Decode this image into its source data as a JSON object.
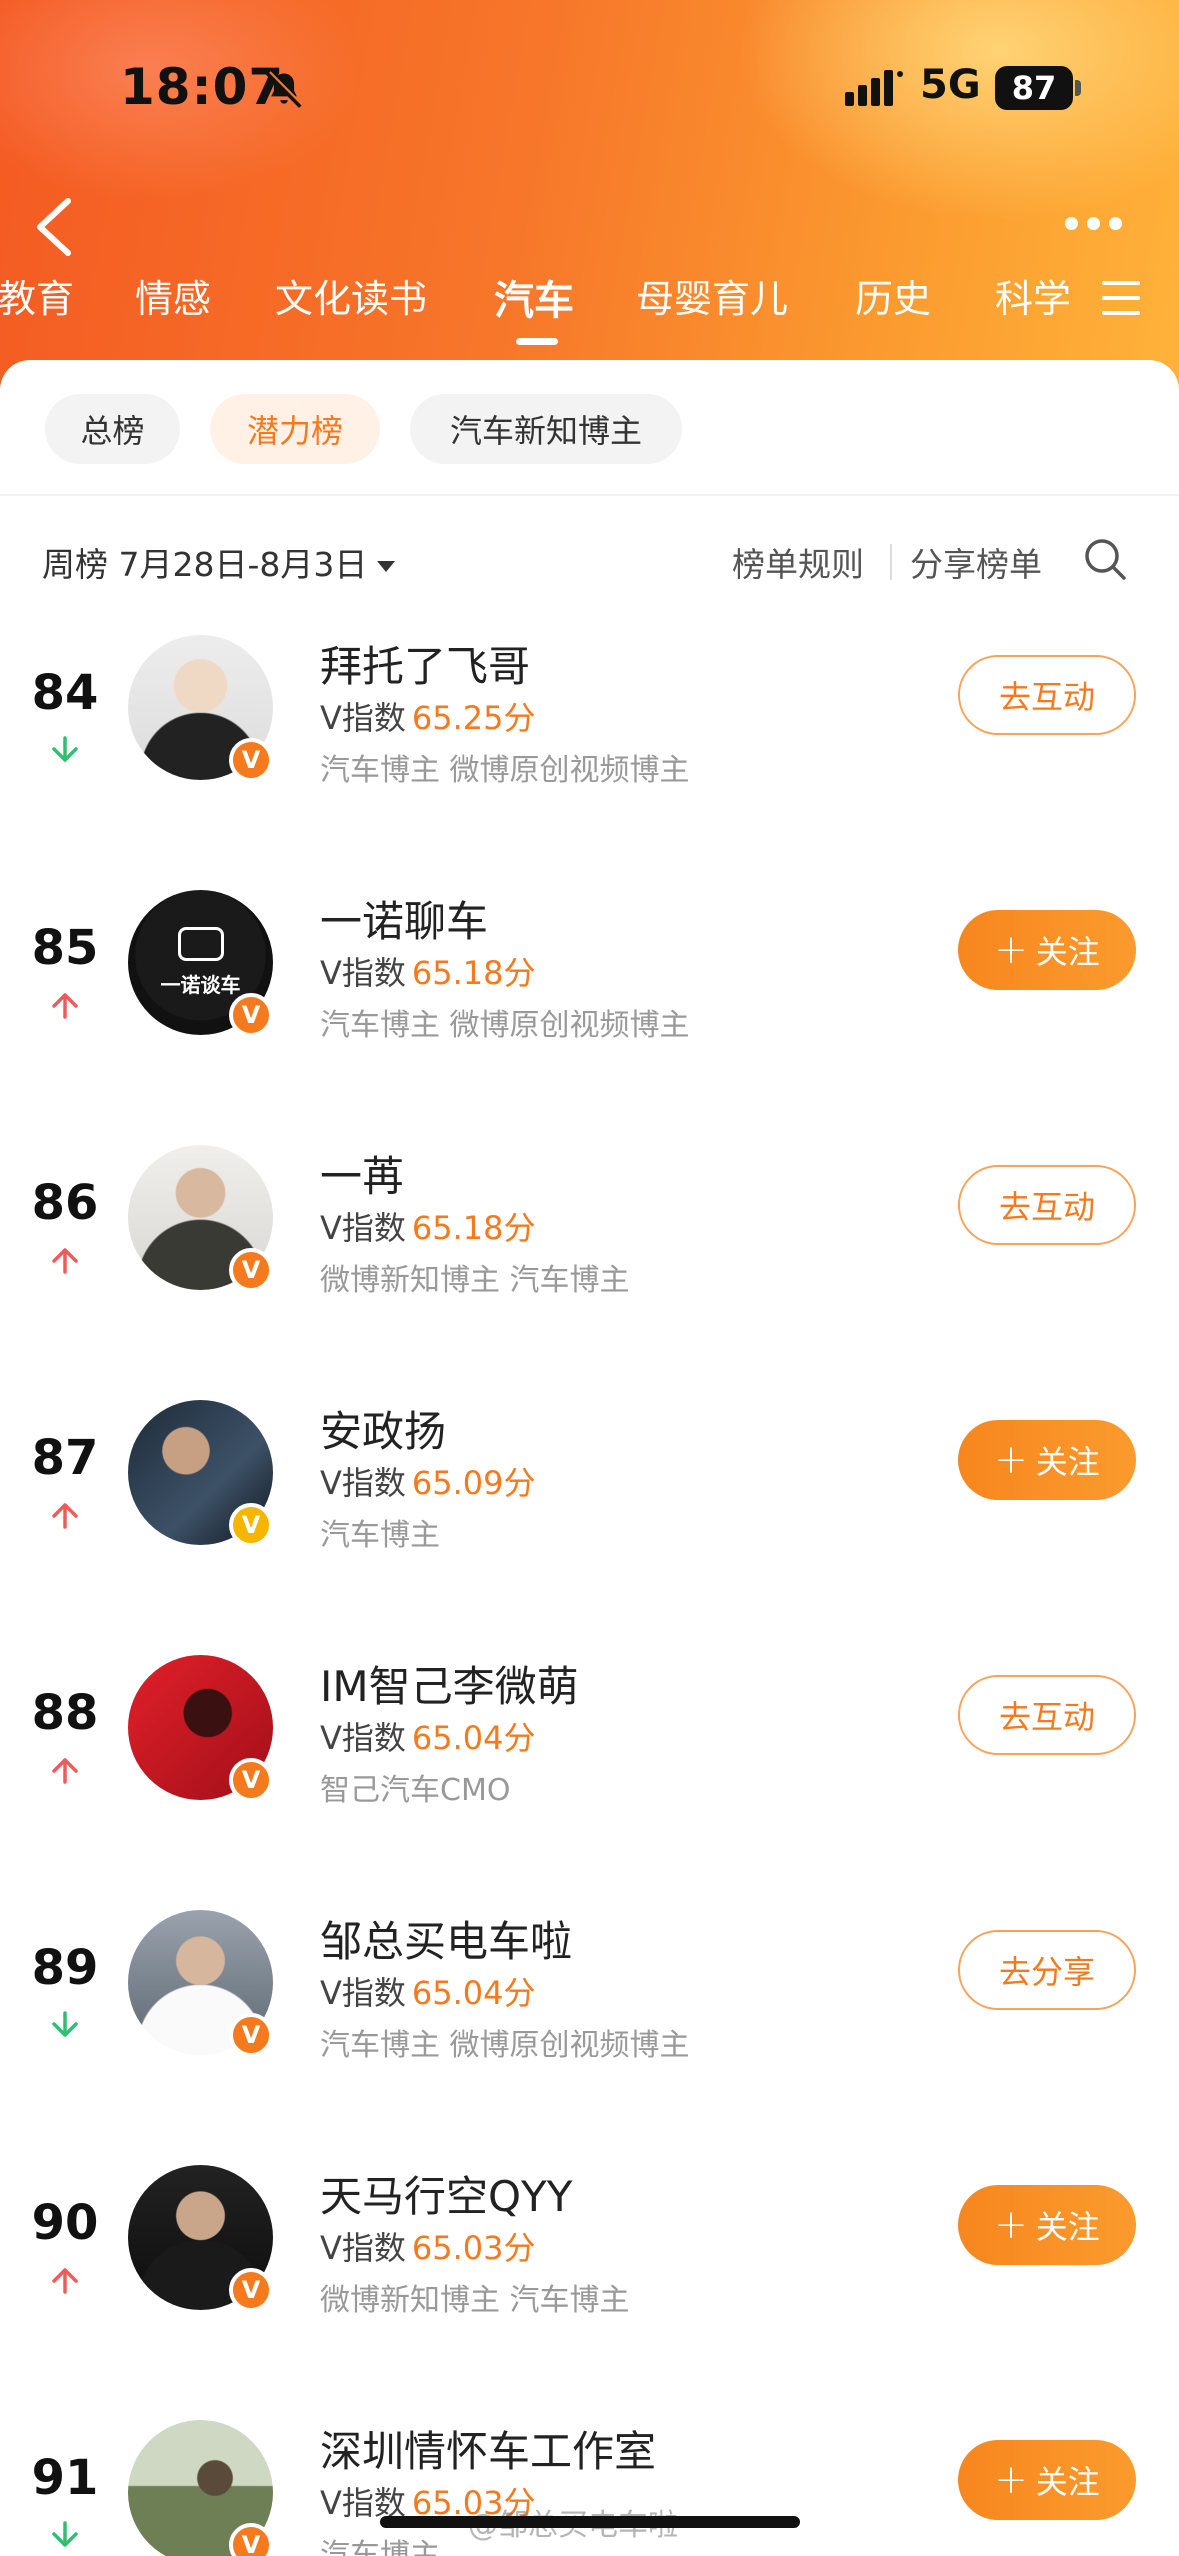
{
  "status_bar": {
    "time": "18:07",
    "network": "5G",
    "battery": "87"
  },
  "categories": [
    {
      "label": "教育"
    },
    {
      "label": "情感"
    },
    {
      "label": "文化读书"
    },
    {
      "label": "汽车"
    },
    {
      "label": "母婴育儿"
    },
    {
      "label": "历史"
    },
    {
      "label": "科学"
    }
  ],
  "active_category": "汽车",
  "sub_tabs": [
    {
      "label": "总榜"
    },
    {
      "label": "潜力榜"
    },
    {
      "label": "汽车新知博主"
    }
  ],
  "active_sub_tab": "潜力榜",
  "filter": {
    "week_label": "周榜 7月28日-8月3日",
    "rules_label": "榜单规则",
    "share_label": "分享榜单"
  },
  "colors": {
    "accent": "#f57a1e",
    "up": "#ee5b5b",
    "down": "#2fbf71"
  },
  "v_index_label": "V指数",
  "rankings": [
    {
      "rank": "84",
      "trend": "down",
      "name": "拜托了飞哥",
      "score": "65.25分",
      "tags": "汽车博主 微博原创视频博主",
      "action": "去互动",
      "action_type": "outline",
      "badge": "orange"
    },
    {
      "rank": "85",
      "trend": "up",
      "name": "一诺聊车",
      "score": "65.18分",
      "tags": "汽车博主 微博原创视频博主",
      "action": "关注",
      "action_type": "follow",
      "badge": "orange",
      "avatar_text": "一诺谈车"
    },
    {
      "rank": "86",
      "trend": "up",
      "name": "一苒",
      "score": "65.18分",
      "tags": "微博新知博主 汽车博主",
      "action": "去互动",
      "action_type": "outline",
      "badge": "orange"
    },
    {
      "rank": "87",
      "trend": "up",
      "name": "安政扬",
      "score": "65.09分",
      "tags": "汽车博主",
      "action": "关注",
      "action_type": "follow",
      "badge": "gold"
    },
    {
      "rank": "88",
      "trend": "up",
      "name": "IM智己李微萌",
      "score": "65.04分",
      "tags": "智己汽车CMO",
      "action": "去互动",
      "action_type": "outline",
      "badge": "orange"
    },
    {
      "rank": "89",
      "trend": "down",
      "name": "邹总买电车啦",
      "score": "65.04分",
      "tags": "汽车博主 微博原创视频博主",
      "action": "去分享",
      "action_type": "outline",
      "badge": "orange"
    },
    {
      "rank": "90",
      "trend": "up",
      "name": "天马行空QYY",
      "score": "65.03分",
      "tags": "微博新知博主 汽车博主",
      "action": "关注",
      "action_type": "follow",
      "badge": "orange"
    },
    {
      "rank": "91",
      "trend": "down",
      "name": "深圳情怀车工作室",
      "score": "65.03分",
      "tags": "汽车博主",
      "action": "关注",
      "action_type": "follow",
      "badge": "orange"
    }
  ],
  "watermark": "@邹总买电车啦"
}
